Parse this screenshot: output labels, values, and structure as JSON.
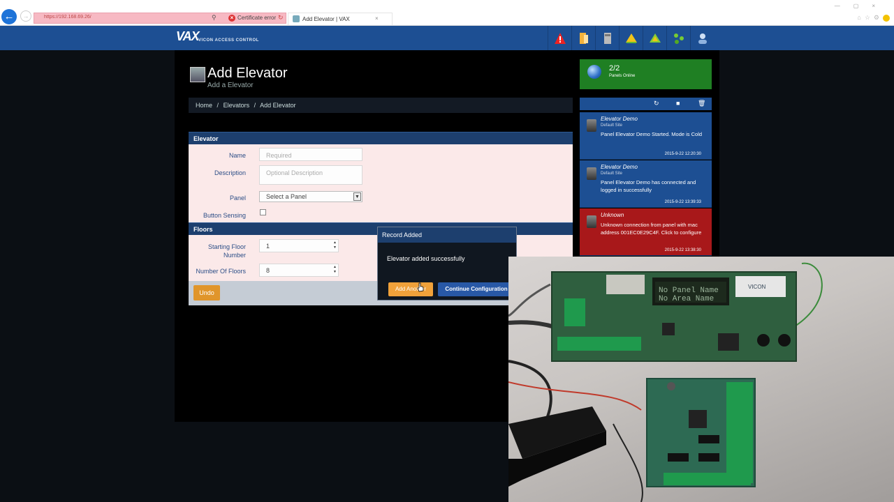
{
  "browser": {
    "url": "https://192.168.69.26/",
    "cert_error": "Certificate error",
    "tab_title": "Add Elevator | VAX"
  },
  "header": {
    "logo_mark": "VAX",
    "logo_text": "VICON ACCESS CONTROL",
    "icons": [
      "alert-icon",
      "doors-icon",
      "panel-icon",
      "warning-icon",
      "map-icon",
      "network-icon",
      "user-icon"
    ]
  },
  "page": {
    "title": "Add Elevator",
    "subtitle": "Add a Elevator"
  },
  "breadcrumb": [
    "Home",
    "/",
    "Elevators",
    "/",
    "Add Elevator"
  ],
  "form": {
    "section_elevator": "Elevator",
    "name_label": "Name",
    "name_placeholder": "Required",
    "description_label": "Description",
    "description_placeholder": "Optional Description",
    "panel_label": "Panel",
    "panel_value": "Select a Panel",
    "button_sensing_label": "Button Sensing",
    "section_floors": "Floors",
    "starting_floor_label": "Starting Floor Number",
    "starting_floor_value": "1",
    "number_floors_label": "Number Of Floors",
    "number_floors_value": "8",
    "undo_label": "Undo"
  },
  "modal": {
    "title": "Record Added",
    "message": "Elevator added successfully",
    "add_another": "Add Another",
    "continue": "Continue Configuration"
  },
  "status": {
    "count": "2/2",
    "label": "Panels Online"
  },
  "events": [
    {
      "title": "Elevator Demo",
      "site": "Default Site",
      "message": "Panel Elevator Demo Started. Mode is Cold",
      "time": "2015-9-22 12:20:30"
    },
    {
      "title": "Elevator Demo",
      "site": "Default Site",
      "message": "Panel Elevator Demo has connected and logged in successfully",
      "time": "2015-9-22 13:39:33"
    },
    {
      "title": "Unknown",
      "site": "",
      "message": "Unknown connection from panel with mac address 001EC0E29C4F. Click to configure",
      "time": "2015-9-22 13:38:30"
    }
  ],
  "photo": {
    "lcd_line1": "No Panel Name",
    "lcd_line2": "No Area Name",
    "brand": "VICON"
  }
}
